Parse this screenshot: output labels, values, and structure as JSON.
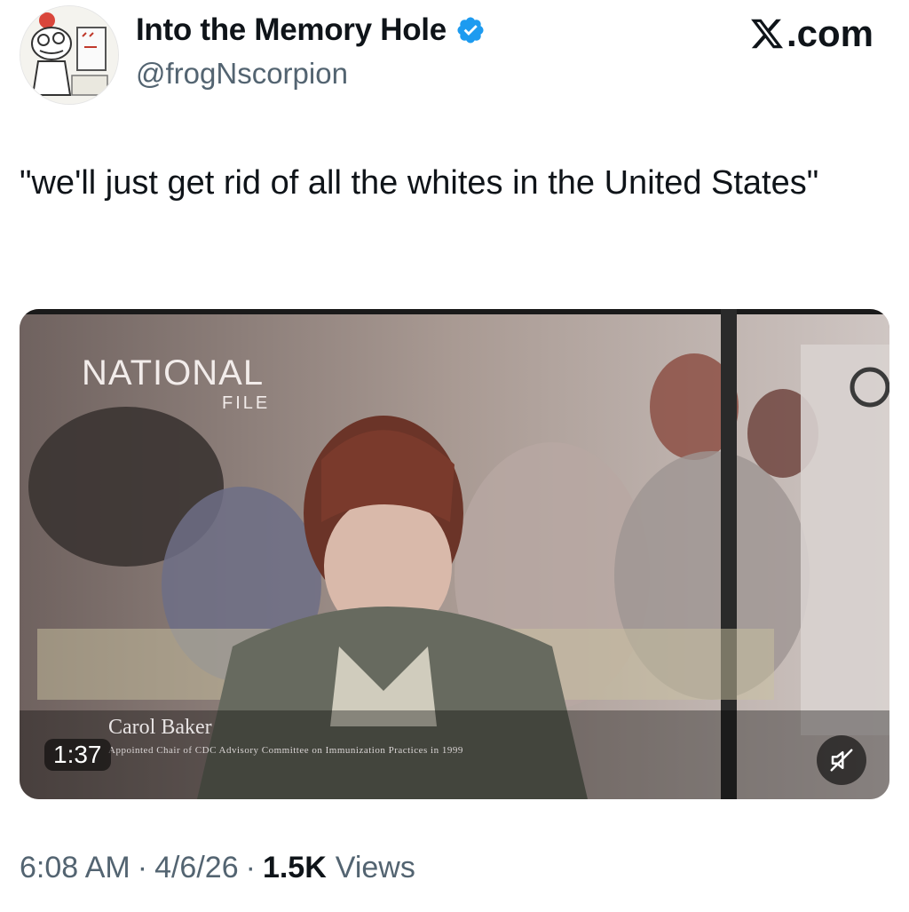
{
  "author": {
    "display_name": "Into the Memory Hole",
    "handle": "@frogNscorpion",
    "verified": true,
    "verified_color": "#1d9bf0",
    "avatar_icon": "cartoon-frog-avatar-icon"
  },
  "brand": {
    "label": ".com",
    "icon": "x-logo-icon"
  },
  "tweet": {
    "text": "\"we'll just get rid of all the whites in the United States\""
  },
  "video": {
    "watermark_main": "NATIONAL",
    "watermark_sub": "FILE",
    "caption_name": "Carol Baker",
    "caption_title": "Appointed Chair of CDC Advisory Committee on Immunization Practices in 1999",
    "duration": "1:37",
    "mute_icon": "muted-speaker-icon"
  },
  "meta": {
    "time": "6:08 AM",
    "date": "4/6/26",
    "separator": "·",
    "views_count": "1.5K",
    "views_label": "Views"
  }
}
